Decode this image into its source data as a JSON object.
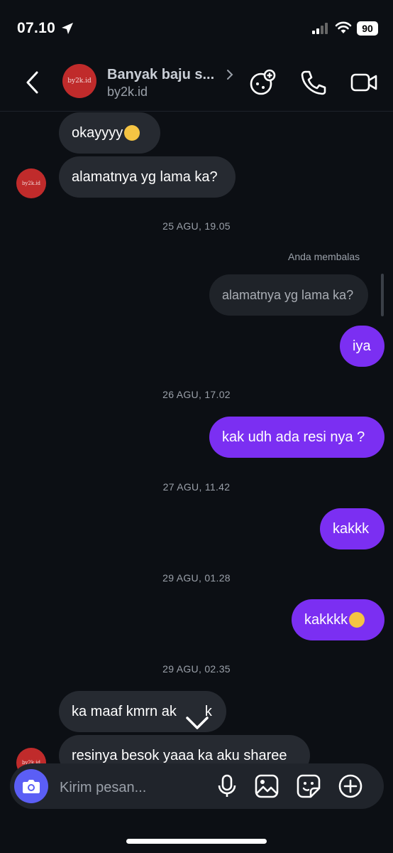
{
  "status_bar": {
    "time": "07.10",
    "battery": "90"
  },
  "header": {
    "title": "Banyak baju s...",
    "subtitle": "by2k.id",
    "avatar_text": "by2k.id",
    "icons": [
      "back-chevron-icon",
      "chevron-right-icon",
      "effects-icon",
      "phone-icon",
      "video-icon"
    ]
  },
  "messages": {
    "m1": "okayyyy",
    "m2": "alamatnya yg lama ka?",
    "ts1": "25 AGU, 19.05",
    "reply_label": "Anda membalas",
    "quoted": "alamatnya yg lama ka?",
    "m3": "iya",
    "ts2": "26 AGU, 17.02",
    "m4": "kak udh ada resi nya ?",
    "ts3": "27 AGU, 11.42",
    "m5": "kakkk",
    "ts4": "29 AGU, 01.28",
    "m6": "kakkkk",
    "ts5": "29 AGU, 02.35",
    "m7": "ka maaf kmrn ak",
    "m7_tail": "k",
    "m8": "resinya besok yaaa ka aku sharee"
  },
  "composer": {
    "placeholder": "Kirim pesan...",
    "icons": [
      "camera-icon",
      "microphone-icon",
      "image-icon",
      "sticker-icon",
      "plus-icon"
    ]
  },
  "colors": {
    "background": "#0c0f14",
    "sent": "#7b2ff2",
    "received": "#262a31",
    "camera": "#5b5ef5"
  }
}
